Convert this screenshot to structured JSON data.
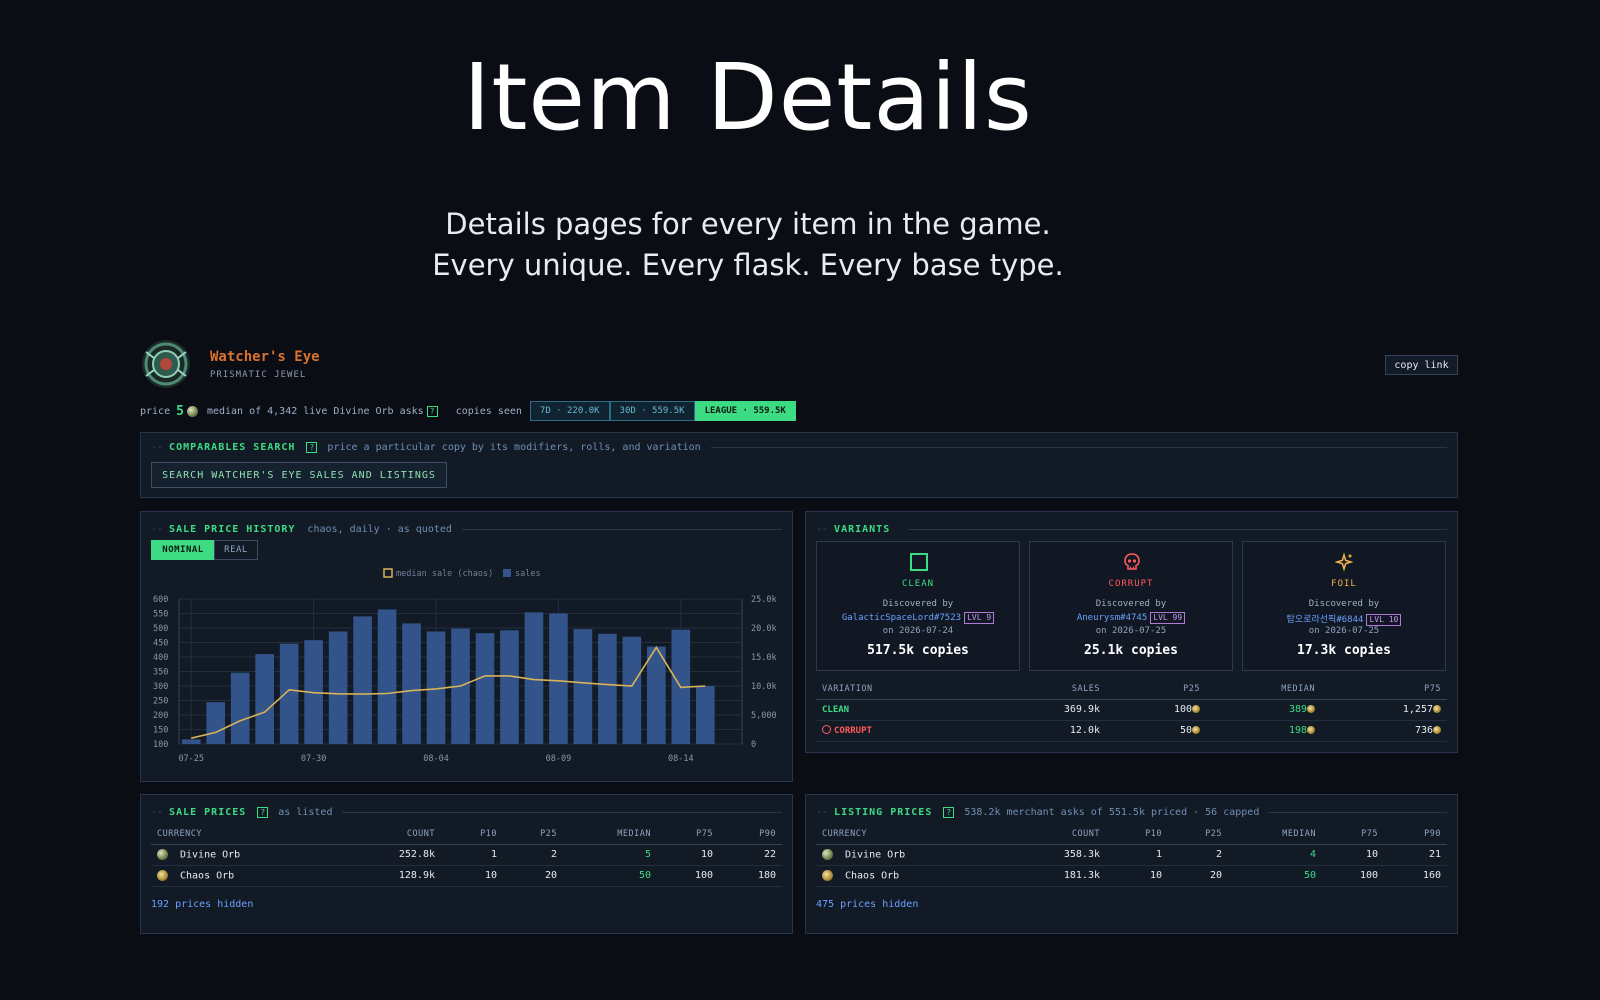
{
  "hero": {
    "title": "Item Details",
    "subtitle_line1": "Details pages for every item in the game.",
    "subtitle_line2": "Every unique. Every flask. Every base type."
  },
  "item": {
    "name": "Watcher's Eye",
    "base": "PRISMATIC JEWEL",
    "copy_link_label": "copy link",
    "price_label": "price",
    "price_value": "5",
    "price_note": "median of 4,342 live Divine Orb asks",
    "copies_seen_label": "copies seen",
    "copies_tabs": [
      "7D · 220.0K",
      "30D · 559.5K",
      "LEAGUE · 559.5K"
    ],
    "copies_active": 2
  },
  "comparables": {
    "title": "COMPARABLES SEARCH",
    "hint": "price a particular copy by its modifiers, rolls, and variation",
    "button": "SEARCH WATCHER'S EYE SALES AND LISTINGS"
  },
  "history": {
    "title": "SALE PRICE HISTORY",
    "hint": "chaos, daily · as quoted",
    "toggles": [
      "NOMINAL",
      "REAL"
    ],
    "toggle_active": 0
  },
  "chart_data": {
    "type": "bar",
    "legend": [
      "median sale (chaos)",
      "sales"
    ],
    "x": [
      "07-25",
      "07-26",
      "07-27",
      "07-28",
      "07-29",
      "07-30",
      "07-31",
      "08-01",
      "08-02",
      "08-03",
      "08-04",
      "08-05",
      "08-06",
      "08-07",
      "08-08",
      "08-09",
      "08-10",
      "08-11",
      "08-12",
      "08-13",
      "08-14",
      "08-15",
      "08-16"
    ],
    "x_ticks": [
      "07-25",
      "07-30",
      "08-04",
      "08-09",
      "08-14"
    ],
    "left_axis": {
      "ticks": [
        "600",
        "550",
        "500",
        "450",
        "400",
        "350",
        "300",
        "250",
        "200",
        "150",
        "100"
      ],
      "ylim": [
        100,
        600
      ]
    },
    "right_axis": {
      "ticks": [
        "25.0k",
        "20.0k",
        "15.0k",
        "10.0k",
        "5,000",
        "0"
      ],
      "ylim": [
        0,
        25000
      ]
    },
    "series": [
      {
        "name": "sales",
        "kind": "bar",
        "axis": "right",
        "values": [
          800,
          7200,
          12300,
          15500,
          17300,
          17900,
          19400,
          22000,
          23200,
          20800,
          19400,
          19900,
          19100,
          19600,
          22700,
          22500,
          19800,
          19000,
          18500,
          16800,
          19700,
          10000,
          0
        ]
      },
      {
        "name": "median sale (chaos)",
        "kind": "line",
        "axis": "left",
        "values": [
          120,
          140,
          180,
          210,
          287,
          277,
          273,
          272,
          274,
          284,
          290,
          300,
          335,
          335,
          322,
          318,
          311,
          305,
          300,
          433,
          295,
          300,
          null
        ]
      }
    ],
    "colors": {
      "bar": "#33548a",
      "line": "#d8b35a"
    }
  },
  "variants": {
    "title": "VARIANTS",
    "cards": [
      {
        "name": "CLEAN",
        "icon": "square-icon",
        "color": "#3ddc84",
        "discovered_label": "Discovered by",
        "who": "GalacticSpaceLord#7523",
        "lvl": "LVL 9",
        "on_label": "on",
        "date": "2026-07-24",
        "copies": "517.5k copies"
      },
      {
        "name": "CORRUPT",
        "icon": "skull-icon",
        "color": "#ff5a5a",
        "discovered_label": "Discovered by",
        "who": "Aneurysm#4745",
        "lvl": "LVL 99",
        "on_label": "on",
        "date": "2026-07-25",
        "copies": "25.1k copies"
      },
      {
        "name": "FOIL",
        "icon": "sparkle-icon",
        "color": "#f0b54a",
        "discovered_label": "Discovered by",
        "who": "탑오로라선픽#6844",
        "lvl": "LVL 10",
        "on_label": "on",
        "date": "2026-07-25",
        "copies": "17.3k copies"
      }
    ],
    "table": {
      "headers": [
        "VARIATION",
        "SALES",
        "P25",
        "MEDIAN",
        "P75"
      ],
      "rows": [
        {
          "variation": "CLEAN",
          "sales": "369.9k",
          "p25": "100",
          "median": "389",
          "p75": "1,257"
        },
        {
          "variation": "CORRUPT",
          "sales": "12.0k",
          "p25": "50",
          "median": "198",
          "p75": "736"
        }
      ]
    }
  },
  "sale_prices": {
    "title": "SALE PRICES",
    "hint": "as listed",
    "headers": [
      "CURRENCY",
      "COUNT",
      "P10",
      "P25",
      "MEDIAN",
      "P75",
      "P90"
    ],
    "rows": [
      {
        "currency": "Divine Orb",
        "count": "252.8k",
        "p10": "1",
        "p25": "2",
        "median": "5",
        "p75": "10",
        "p90": "22"
      },
      {
        "currency": "Chaos Orb",
        "count": "128.9k",
        "p10": "10",
        "p25": "20",
        "median": "50",
        "p75": "100",
        "p90": "180"
      }
    ],
    "hidden": "192 prices hidden"
  },
  "listing_prices": {
    "title": "LISTING PRICES",
    "hint": "538.2k merchant asks of 551.5k priced · 56 capped",
    "headers": [
      "CURRENCY",
      "COUNT",
      "P10",
      "P25",
      "MEDIAN",
      "P75",
      "P90"
    ],
    "rows": [
      {
        "currency": "Divine Orb",
        "count": "358.3k",
        "p10": "1",
        "p25": "2",
        "median": "4",
        "p75": "10",
        "p90": "21"
      },
      {
        "currency": "Chaos Orb",
        "count": "181.3k",
        "p10": "10",
        "p25": "20",
        "median": "50",
        "p75": "100",
        "p90": "160"
      }
    ],
    "hidden": "475 prices hidden"
  }
}
